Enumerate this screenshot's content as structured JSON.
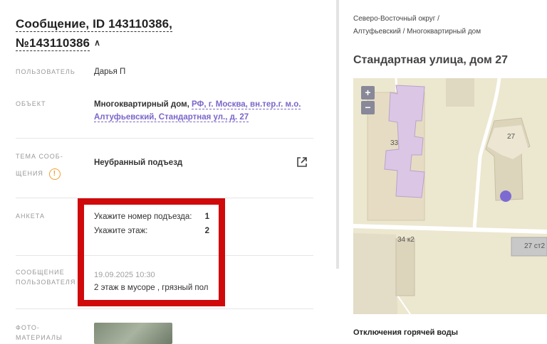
{
  "message": {
    "title_line1": "Сообщение, ID 143110386,",
    "title_line2": "№143110386",
    "rows": {
      "user": {
        "label": "ПОЛЬЗОВАТЕЛЬ",
        "value": "Дарья П"
      },
      "object": {
        "label": "ОБЪЕКТ",
        "type": "Многоквартирный дом,",
        "address_line1": "РФ, г. Москва, вн.тер.г. м.о.",
        "address_line2": "Алтуфьевский, Стандартная ул., д. 27"
      },
      "topic": {
        "label_line1": "ТЕМА СООБ-",
        "label_line2": "ЩЕНИЯ",
        "value": "Неубранный подъезд"
      },
      "survey": {
        "label": "АНКЕТА",
        "items": [
          {
            "q": "Укажите номер подъезда:",
            "a": "1"
          },
          {
            "q": "Укажите этаж:",
            "a": "2"
          }
        ]
      },
      "user_message": {
        "label_line1": "СООБЩЕНИЕ",
        "label_line2": "ПОЛЬЗОВАТЕЛЯ",
        "timestamp": "19.09.2025 10:30",
        "text": "2 этаж в мусоре , грязный пол"
      },
      "photos": {
        "label_line1": "ФОТО-",
        "label_line2": "МАТЕРИАЛЫ"
      }
    }
  },
  "sidebar": {
    "breadcrumb_line1": "Северо-Восточный округ /",
    "breadcrumb_line2": "Алтуфьевский / Многоквартирный дом",
    "title": "Стандартная улица, дом 27",
    "map": {
      "zoom_in": "+",
      "zoom_out": "−",
      "building_labels": [
        "33",
        "27",
        "34 к2",
        "27 ст2"
      ]
    },
    "footer_heading": "Отключения горячей воды"
  },
  "colors": {
    "accent": "#7b66c9",
    "highlight_border": "#d0090b",
    "warning": "#f0a030"
  }
}
